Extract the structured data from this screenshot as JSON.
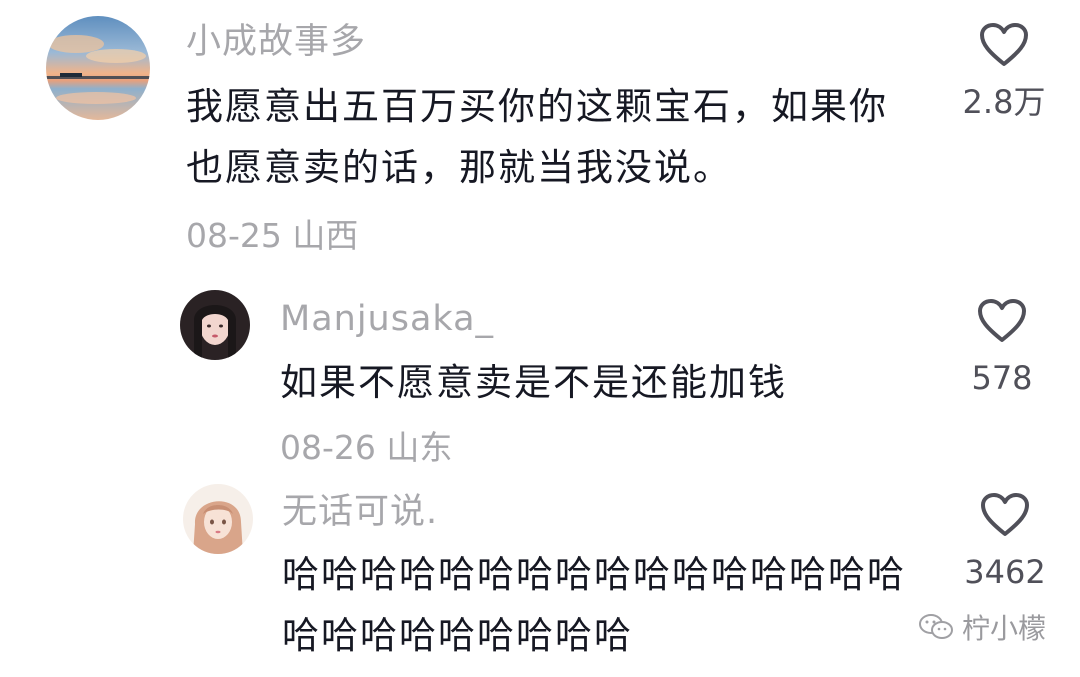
{
  "comments": [
    {
      "username": "小成故事多",
      "text": "我愿意出五百万买你的这颗宝石，如果你也愿意卖的话，那就当我没说。",
      "date": "08-25",
      "location": "山西",
      "likes": "2.8万",
      "avatar_icon": "sunset-lake-avatar"
    },
    {
      "username": "Manjusaka_",
      "text": "如果不愿意卖是不是还能加钱",
      "date": "08-26",
      "location": "山东",
      "likes": "578",
      "avatar_icon": "dark-hair-girl-avatar"
    },
    {
      "username": "无话可说.",
      "text": "哈哈哈哈哈哈哈哈哈哈哈哈哈哈哈哈哈哈哈哈哈哈哈哈哈",
      "date": "",
      "location": "",
      "likes": "3462",
      "avatar_icon": "anime-girl-avatar"
    }
  ],
  "watermark": {
    "text": "柠小檬",
    "icon": "wechat-icon"
  },
  "colors": {
    "text_primary": "#161823",
    "text_secondary": "#a7a7ab",
    "heart_stroke": "#505059"
  }
}
